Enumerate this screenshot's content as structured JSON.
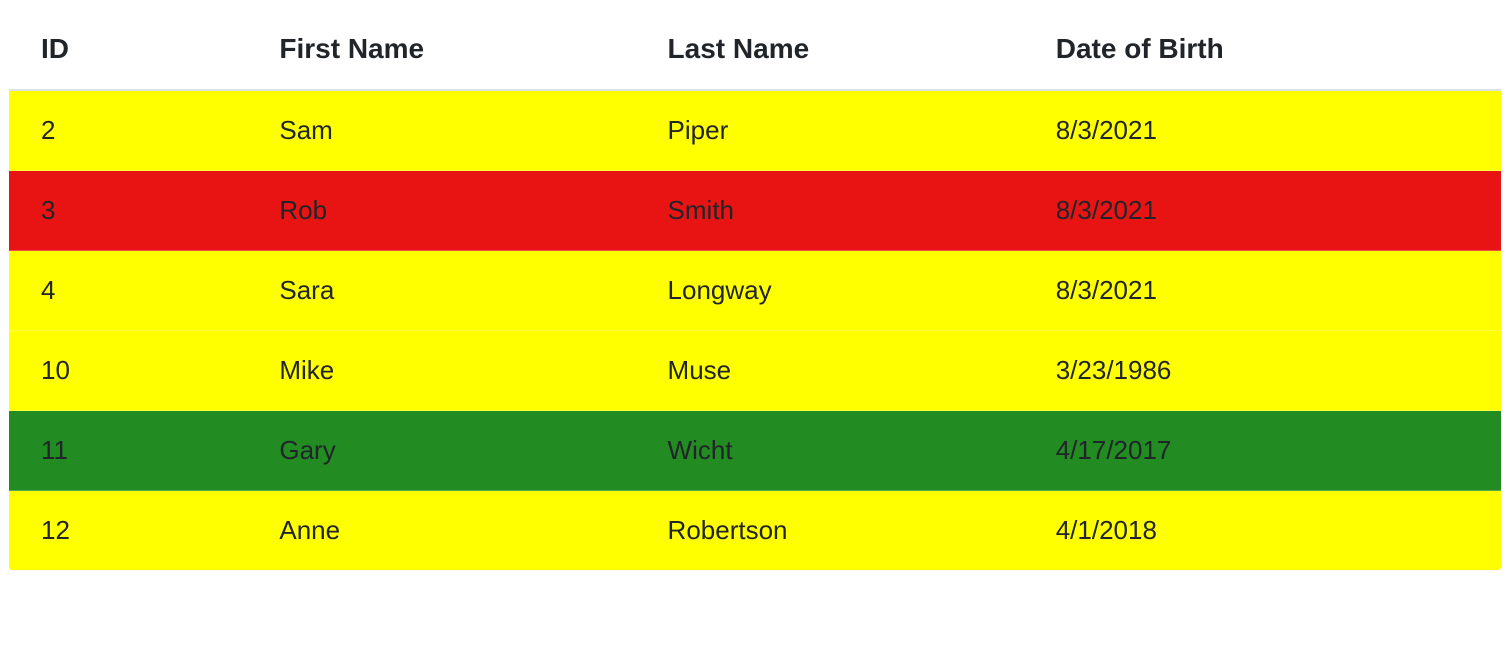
{
  "table": {
    "headers": {
      "id": "ID",
      "first_name": "First Name",
      "last_name": "Last Name",
      "dob": "Date of Birth"
    },
    "rows": [
      {
        "id": "2",
        "first_name": "Sam",
        "last_name": "Piper",
        "dob": "8/3/2021",
        "color": "yellow"
      },
      {
        "id": "3",
        "first_name": "Rob",
        "last_name": "Smith",
        "dob": "8/3/2021",
        "color": "red"
      },
      {
        "id": "4",
        "first_name": "Sara",
        "last_name": "Longway",
        "dob": "8/3/2021",
        "color": "yellow"
      },
      {
        "id": "10",
        "first_name": "Mike",
        "last_name": "Muse",
        "dob": "3/23/1986",
        "color": "yellow"
      },
      {
        "id": "11",
        "first_name": "Gary",
        "last_name": "Wicht",
        "dob": "4/17/2017",
        "color": "green"
      },
      {
        "id": "12",
        "first_name": "Anne",
        "last_name": "Robertson",
        "dob": "4/1/2018",
        "color": "yellow"
      }
    ]
  },
  "colors": {
    "yellow": "#ffff00",
    "red": "#e81313",
    "green": "#228b22"
  }
}
